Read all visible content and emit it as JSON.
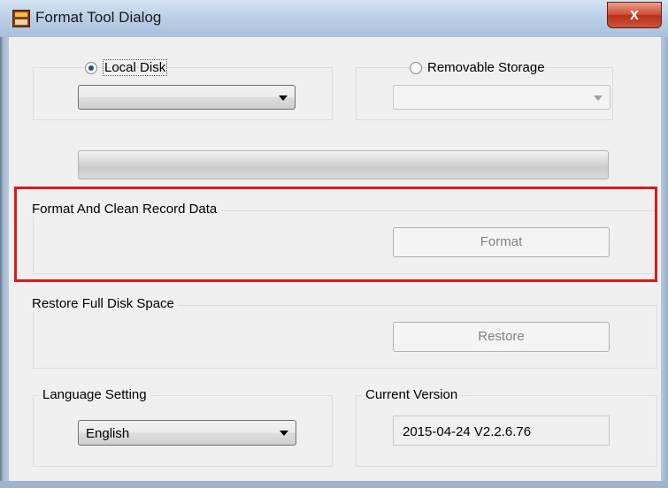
{
  "window": {
    "title": "Format Tool Dialog",
    "close_glyph": "x"
  },
  "disk_selection": {
    "local_disk": {
      "label": "Local Disk",
      "checked": true,
      "combo_value": ""
    },
    "removable_storage": {
      "label": "Removable Storage",
      "checked": false,
      "combo_value": "",
      "enabled": false
    }
  },
  "progress": {
    "value": 0
  },
  "format_section": {
    "title": "Format And Clean Record Data",
    "button_label": "Format",
    "button_enabled": false
  },
  "restore_section": {
    "title": "Restore Full Disk Space",
    "button_label": "Restore",
    "button_enabled": false
  },
  "language": {
    "title": "Language Setting",
    "selected": "English"
  },
  "version": {
    "title": "Current Version",
    "value": "2015-04-24 V2.2.6.76"
  },
  "annotation": {
    "highlight_color": "#e0161b",
    "highlighted_section": "format_section"
  },
  "icons": {
    "app": "app-icon",
    "close": "close-icon",
    "dropdown": "chevron-down-icon"
  }
}
